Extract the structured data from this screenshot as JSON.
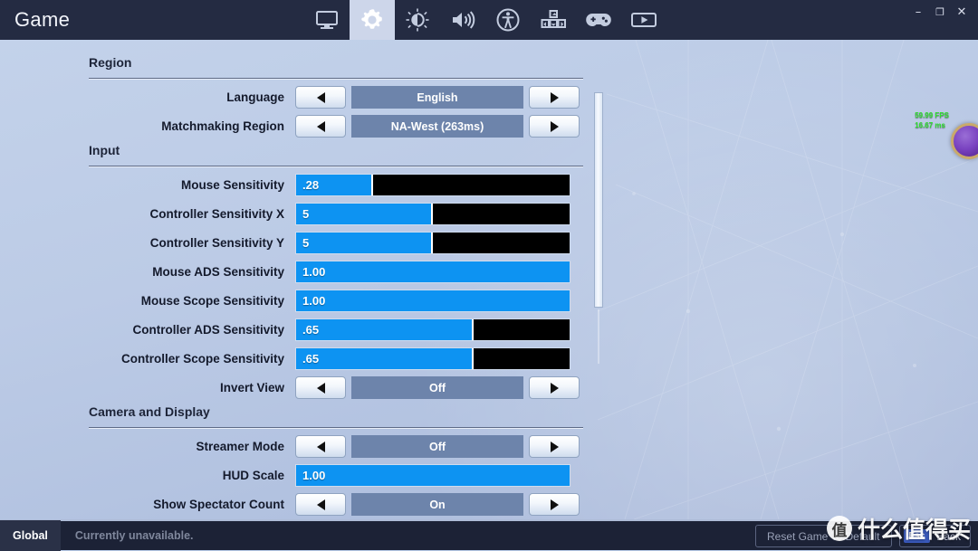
{
  "window": {
    "title": "Game",
    "controls": [
      {
        "name": "minimize",
        "glyph": "–"
      },
      {
        "name": "maximize",
        "glyph": "❐"
      },
      {
        "name": "close",
        "glyph": "✕"
      }
    ]
  },
  "nav": {
    "tabs": [
      {
        "id": "display",
        "icon": "monitor-icon",
        "active": false
      },
      {
        "id": "game",
        "icon": "gear-icon",
        "active": true
      },
      {
        "id": "brightness",
        "icon": "brightness-icon",
        "active": false
      },
      {
        "id": "audio",
        "icon": "speaker-icon",
        "active": false
      },
      {
        "id": "accessibility",
        "icon": "accessibility-icon",
        "active": false
      },
      {
        "id": "input",
        "icon": "keyboard-icon",
        "active": false
      },
      {
        "id": "controller",
        "icon": "gamepad-icon",
        "active": false
      },
      {
        "id": "replays",
        "icon": "replay-icon",
        "active": false
      }
    ]
  },
  "settings": {
    "sections": [
      {
        "title": "Region",
        "rows": [
          {
            "label": "Language",
            "type": "stepper",
            "value": "English"
          },
          {
            "label": "Matchmaking Region",
            "type": "stepper",
            "value": "NA-West (263ms)"
          }
        ]
      },
      {
        "title": "Input",
        "rows": [
          {
            "label": "Mouse Sensitivity",
            "type": "slider",
            "value": ".28",
            "fill_pct": 28
          },
          {
            "label": "Controller Sensitivity X",
            "type": "slider",
            "value": "5",
            "fill_pct": 50
          },
          {
            "label": "Controller Sensitivity Y",
            "type": "slider",
            "value": "5",
            "fill_pct": 50
          },
          {
            "label": "Mouse ADS Sensitivity",
            "type": "slider",
            "value": "1.00",
            "fill_pct": 100
          },
          {
            "label": "Mouse Scope Sensitivity",
            "type": "slider",
            "value": "1.00",
            "fill_pct": 100
          },
          {
            "label": "Controller ADS Sensitivity",
            "type": "slider",
            "value": ".65",
            "fill_pct": 65
          },
          {
            "label": "Controller Scope Sensitivity",
            "type": "slider",
            "value": ".65",
            "fill_pct": 65
          },
          {
            "label": "Invert View",
            "type": "stepper",
            "value": "Off"
          }
        ]
      },
      {
        "title": "Camera and Display",
        "rows": [
          {
            "label": "Streamer Mode",
            "type": "stepper",
            "value": "Off"
          },
          {
            "label": "HUD Scale",
            "type": "slider",
            "value": "1.00",
            "fill_pct": 100
          },
          {
            "label": "Show Spectator Count",
            "type": "stepper",
            "value": "On"
          }
        ]
      }
    ]
  },
  "overlay": {
    "fps": "59.99 FPS",
    "frametime": "16.67 ms"
  },
  "bottom": {
    "chat_scope": "Global",
    "chat_status": "Currently unavailable.",
    "reset_label": "Reset Game To Default",
    "back_key": "Esc",
    "back_label": "Back"
  },
  "watermark": {
    "badge": "值",
    "text": "什么值得买"
  },
  "colors": {
    "accent_blue": "#0d93f2",
    "titlebar": "#242b42",
    "value_box": "#6d84ab",
    "bottombar": "#1c2236",
    "fps_green": "#2fe02f"
  }
}
